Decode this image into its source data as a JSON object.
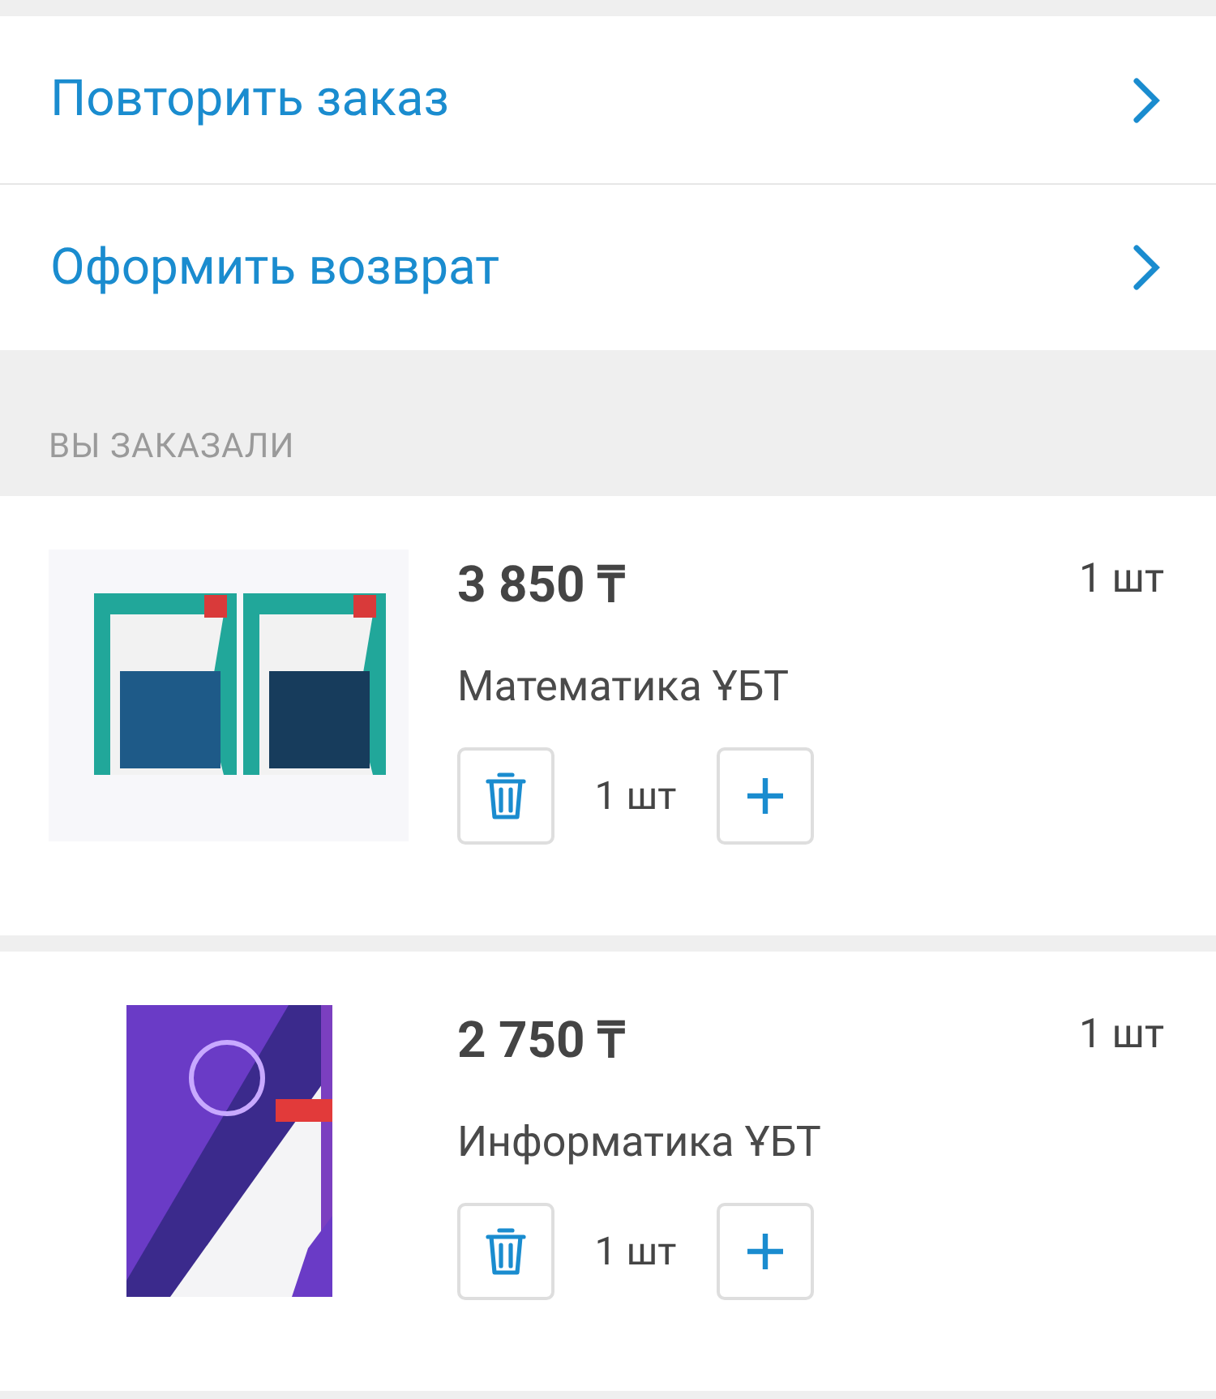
{
  "actions": [
    {
      "label": "Повторить заказ"
    },
    {
      "label": "Оформить возврат"
    }
  ],
  "section_title": "ВЫ ЗАКАЗАЛИ",
  "items": [
    {
      "price": "3 850 ₸",
      "quantity": "1 шт",
      "name": "Математика ҰБТ",
      "stepper_count": "1 шт"
    },
    {
      "price": "2 750 ₸",
      "quantity": "1 шт",
      "name": "Информатика ҰБТ",
      "stepper_count": "1 шт"
    }
  ]
}
